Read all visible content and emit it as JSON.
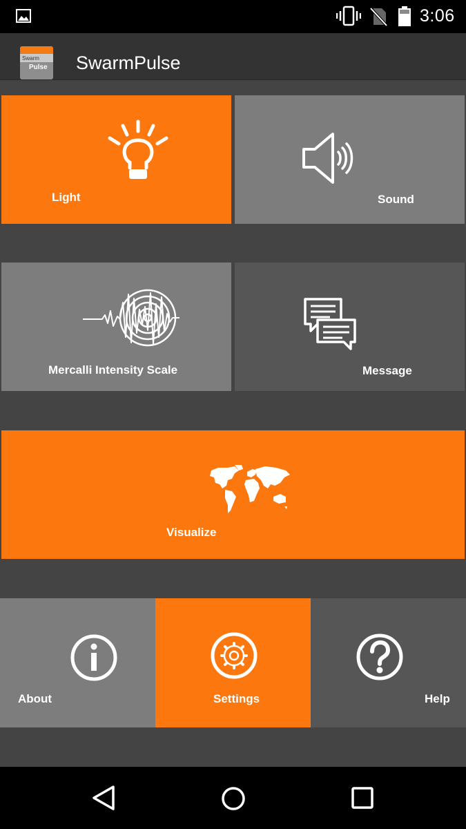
{
  "status_bar": {
    "time": "3:06",
    "icons": [
      "gallery-icon",
      "vibrate-icon",
      "no-sim-icon",
      "battery-icon"
    ]
  },
  "app_bar": {
    "logo_line1": "Swarm",
    "logo_line2": "Pulse",
    "title": "SwarmPulse"
  },
  "tiles": {
    "light": {
      "label": "Light",
      "icon": "lightbulb-icon"
    },
    "sound": {
      "label": "Sound",
      "icon": "speaker-icon"
    },
    "mercalli": {
      "label": "Mercalli Intensity Scale",
      "icon": "seismic-icon"
    },
    "message": {
      "label": "Message",
      "icon": "chat-bubbles-icon"
    },
    "visualize": {
      "label": "Visualize",
      "icon": "world-map-icon"
    },
    "about": {
      "label": "About",
      "icon": "info-icon"
    },
    "settings": {
      "label": "Settings",
      "icon": "gear-icon"
    },
    "help": {
      "label": "Help",
      "icon": "question-icon"
    }
  },
  "colors": {
    "accent": "#fc780f",
    "tile_gray": "#7d7d7d",
    "tile_dark_gray": "#565656",
    "background": "#444444",
    "app_bar": "#333333"
  },
  "nav_bar": {
    "icons": [
      "back-icon",
      "home-icon",
      "recents-icon"
    ]
  }
}
